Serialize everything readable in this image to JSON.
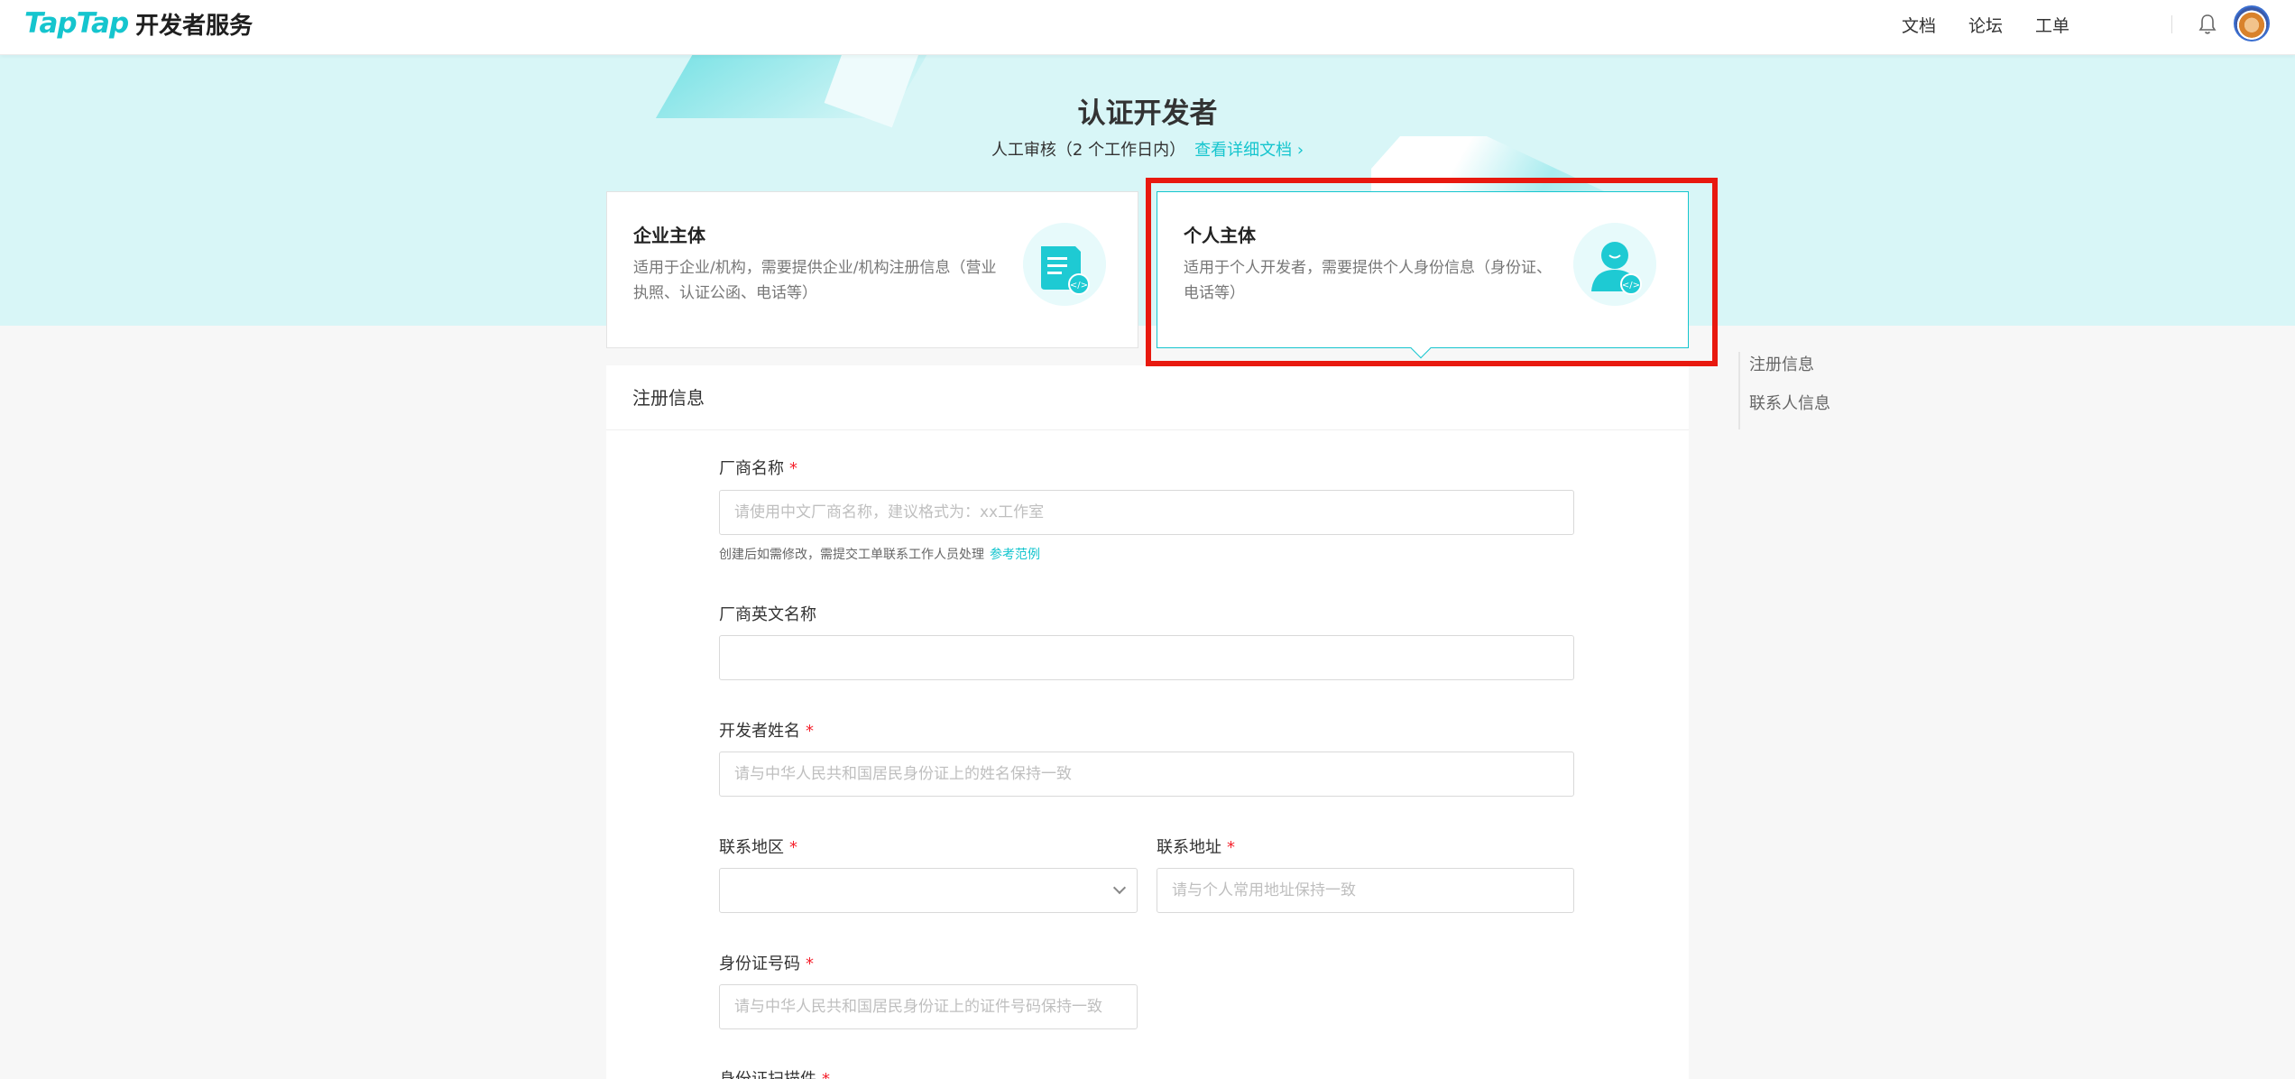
{
  "header": {
    "logo_brand": "TapTap",
    "logo_sub": "开发者服务",
    "nav": [
      "文档",
      "论坛",
      "工单"
    ],
    "bell_icon": "bell-icon",
    "avatar": "user-avatar"
  },
  "hero": {
    "title": "认证开发者",
    "subtitle": "人工审核（2 个工作日内）",
    "doc_link": "查看详细文档 ›"
  },
  "cards": [
    {
      "title": "企业主体",
      "desc": "适用于企业/机构，需要提供企业/机构注册信息（营业执照、认证公函、电话等）",
      "icon": "document-code-icon"
    },
    {
      "title": "个人主体",
      "desc": "适用于个人开发者，需要提供个人身份信息（身份证、电话等）",
      "icon": "person-code-icon",
      "selected": true
    }
  ],
  "anchors": [
    "注册信息",
    "联系人信息"
  ],
  "form": {
    "section_title": "注册信息",
    "vendor_name": {
      "label": "厂商名称",
      "placeholder": "请使用中文厂商名称，建议格式为：xx工作室",
      "hint": "创建后如需修改，需提交工单联系工作人员处理",
      "hint_link": "参考范例"
    },
    "vendor_en_name": {
      "label": "厂商英文名称",
      "placeholder": ""
    },
    "developer_name": {
      "label": "开发者姓名",
      "placeholder": "请与中华人民共和国居民身份证上的姓名保持一致"
    },
    "region": {
      "label": "联系地区",
      "value": ""
    },
    "address": {
      "label": "联系地址",
      "placeholder": "请与个人常用地址保持一致"
    },
    "id_number": {
      "label": "身份证号码",
      "placeholder": "请与中华人民共和国居民身份证上的证件号码保持一致"
    },
    "id_attachment": {
      "label": "身份证扫描件"
    }
  },
  "colors": {
    "accent": "#15c5ce",
    "required": "#f5222d",
    "highlight": "#e8190f"
  }
}
